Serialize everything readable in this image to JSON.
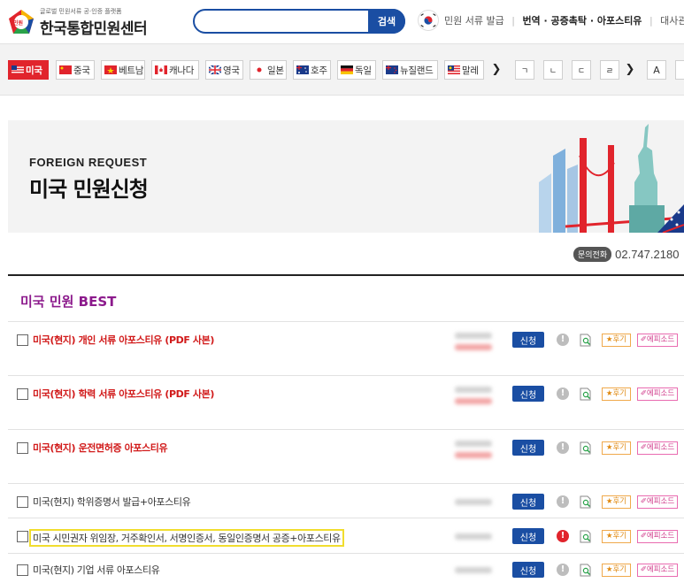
{
  "header": {
    "logo_badge": "민원",
    "logo_sub": "글로벌 민원서류 공·인증 플랫폼",
    "logo_title": "한국통합민원센터",
    "search_placeholder": "",
    "search_button": "검색",
    "nav": [
      {
        "label": "민원 서류 발급",
        "strong": false
      },
      {
        "label": "번역 · 공증촉탁 · 아포스티유",
        "strong": true
      },
      {
        "label": "대사관인증",
        "strong": false
      }
    ]
  },
  "country_tabs": [
    {
      "label": "미국",
      "active": true,
      "flag": "us-flag-icon"
    },
    {
      "label": "중국",
      "active": false,
      "flag": "china-flag-icon"
    },
    {
      "label": "베트남",
      "active": false,
      "flag": "vietnam-flag-icon"
    },
    {
      "label": "캐나다",
      "active": false,
      "flag": "canada-flag-icon"
    },
    {
      "label": "영국",
      "active": false,
      "flag": "uk-flag-icon"
    },
    {
      "label": "일본",
      "active": false,
      "flag": "japan-flag-icon"
    },
    {
      "label": "호주",
      "active": false,
      "flag": "australia-flag-icon"
    },
    {
      "label": "독일",
      "active": false,
      "flag": "germany-flag-icon"
    },
    {
      "label": "뉴질랜드",
      "active": false,
      "flag": "newzealand-flag-icon"
    },
    {
      "label": "말레",
      "active": false,
      "flag": "malaysia-flag-icon"
    }
  ],
  "arrow_glyph": "❯",
  "letter_tabs": [
    "ㄱ",
    "ㄴ",
    "ㄷ",
    "ㄹ",
    "A"
  ],
  "banner": {
    "eyebrow": "FOREIGN REQUEST",
    "title": "미국 민원신청"
  },
  "contact": {
    "pill": "문의전화",
    "number": "02.747.2180"
  },
  "best": {
    "title": "미국 민원 BEST",
    "apply_label": "신청",
    "review_label": "★후기",
    "episode_label": "✐에피소드",
    "items": [
      {
        "title": "미국(현지) 개인 서류 아포스티유 (PDF 사본)",
        "style": "red",
        "sale": true,
        "info": "grey"
      },
      {
        "title": "미국(현지) 학력 서류 아포스티유 (PDF 사본)",
        "style": "red",
        "sale": true,
        "info": "grey"
      },
      {
        "title": "미국(현지) 운전면허증 아포스티유",
        "style": "red",
        "sale": true,
        "info": "grey"
      },
      {
        "title": "미국(현지) 학위증명서 발급+아포스티유",
        "style": "plain",
        "sale": false,
        "info": "grey"
      },
      {
        "title": "미국 시민권자 위임장, 거주확인서, 서명인증서, 동일인증명서 공증+아포스티유",
        "style": "highlight",
        "sale": false,
        "info": "red"
      },
      {
        "title": "미국(현지) 기업 서류 아포스티유",
        "style": "plain",
        "sale": false,
        "info": "grey"
      }
    ]
  }
}
